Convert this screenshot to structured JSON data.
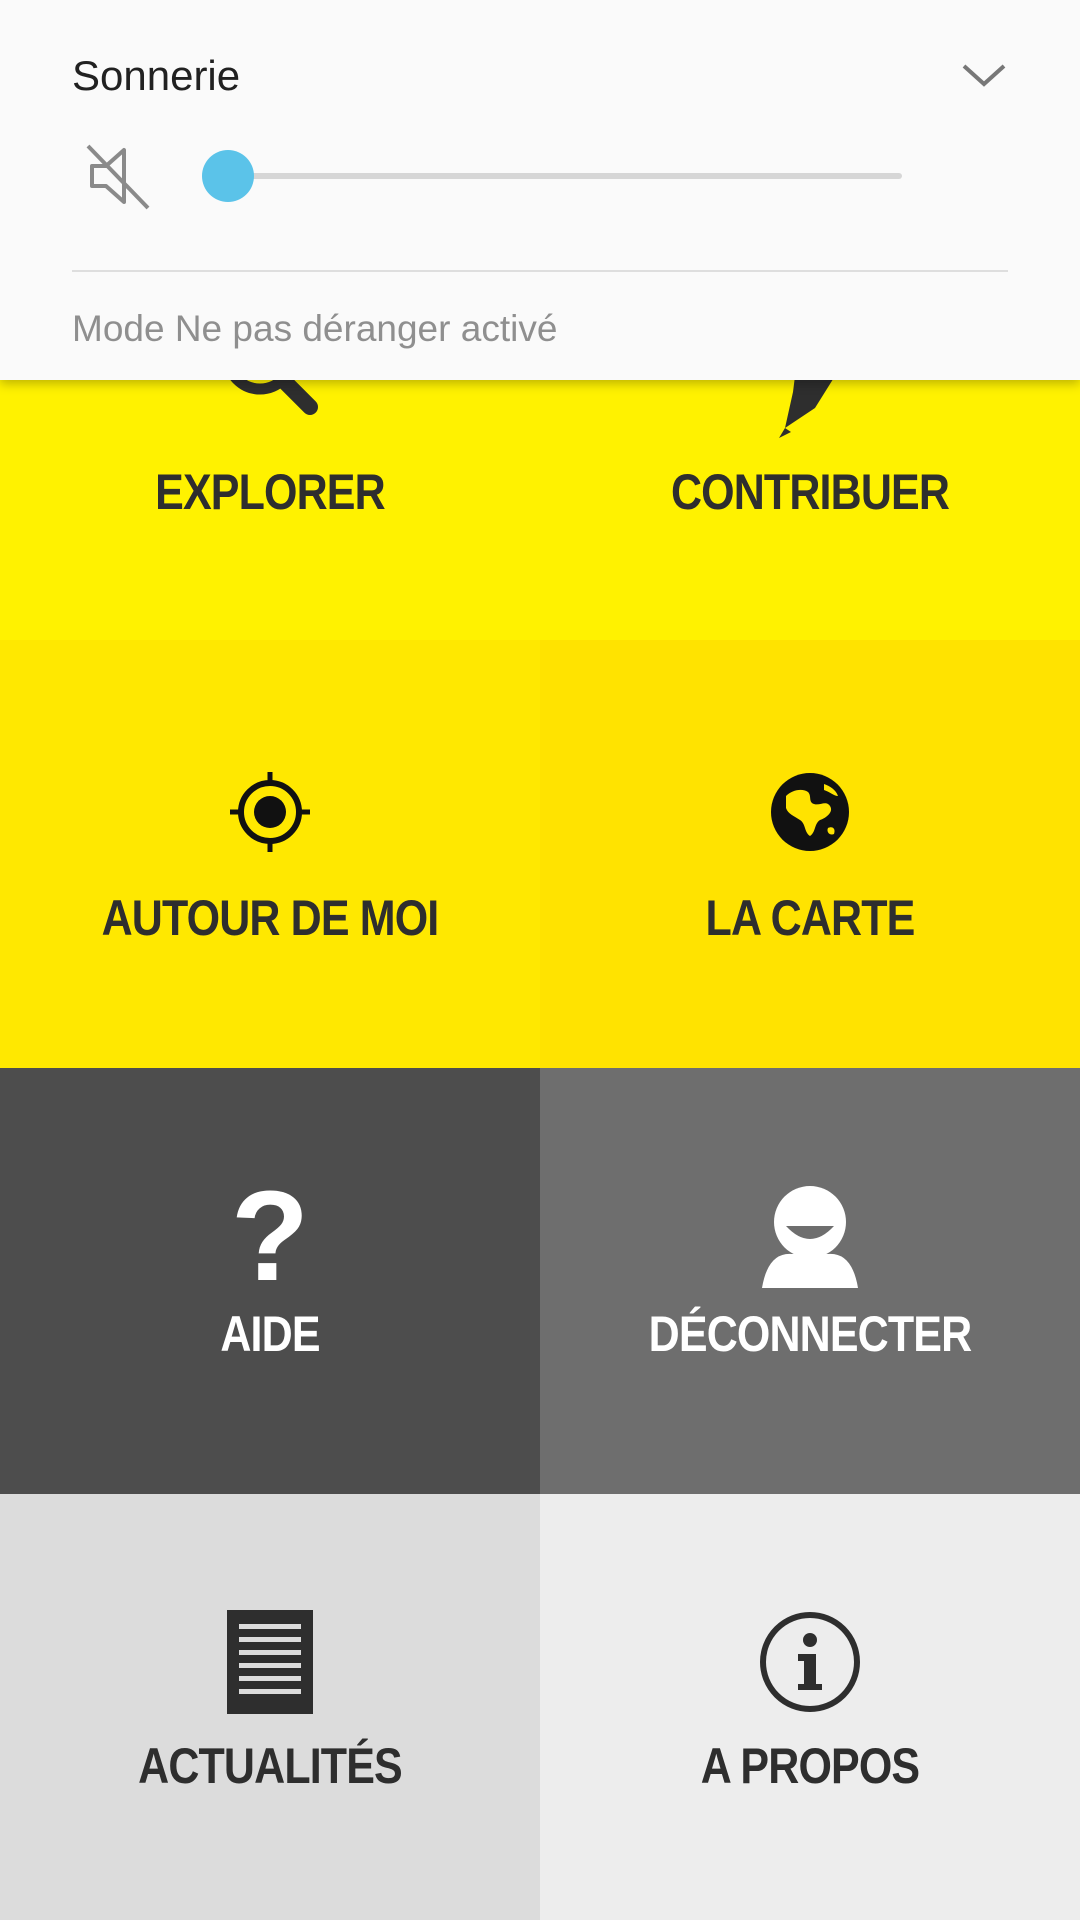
{
  "volume_panel": {
    "title": "Sonnerie",
    "status": "Mode Ne pas déranger activé",
    "slider_level": 0,
    "accent_color": "#5bc3e9",
    "icons": {
      "expand": "chevron-down-icon",
      "mute": "speaker-muted-icon"
    }
  },
  "menu": {
    "tiles": [
      {
        "label": "EXPLORER",
        "icon": "magnifier-icon",
        "color": "#fff200"
      },
      {
        "label": "CONTRIBUER",
        "icon": "pen-icon",
        "color": "#fff200"
      },
      {
        "label": "AUTOUR DE MOI",
        "icon": "target-location-icon",
        "color": "#ffe800"
      },
      {
        "label": "LA CARTE",
        "icon": "globe-icon",
        "color": "#ffe300"
      },
      {
        "label": "AIDE",
        "icon": "question-mark-icon",
        "color": "#4d4d4d"
      },
      {
        "label": "DÉCONNECTER",
        "icon": "user-icon",
        "color": "#6e6e6e"
      },
      {
        "label": "ACTUALITÉS",
        "icon": "document-lines-icon",
        "color": "#dcdcdc"
      },
      {
        "label": "A PROPOS",
        "icon": "info-icon",
        "color": "#ededed"
      }
    ]
  }
}
